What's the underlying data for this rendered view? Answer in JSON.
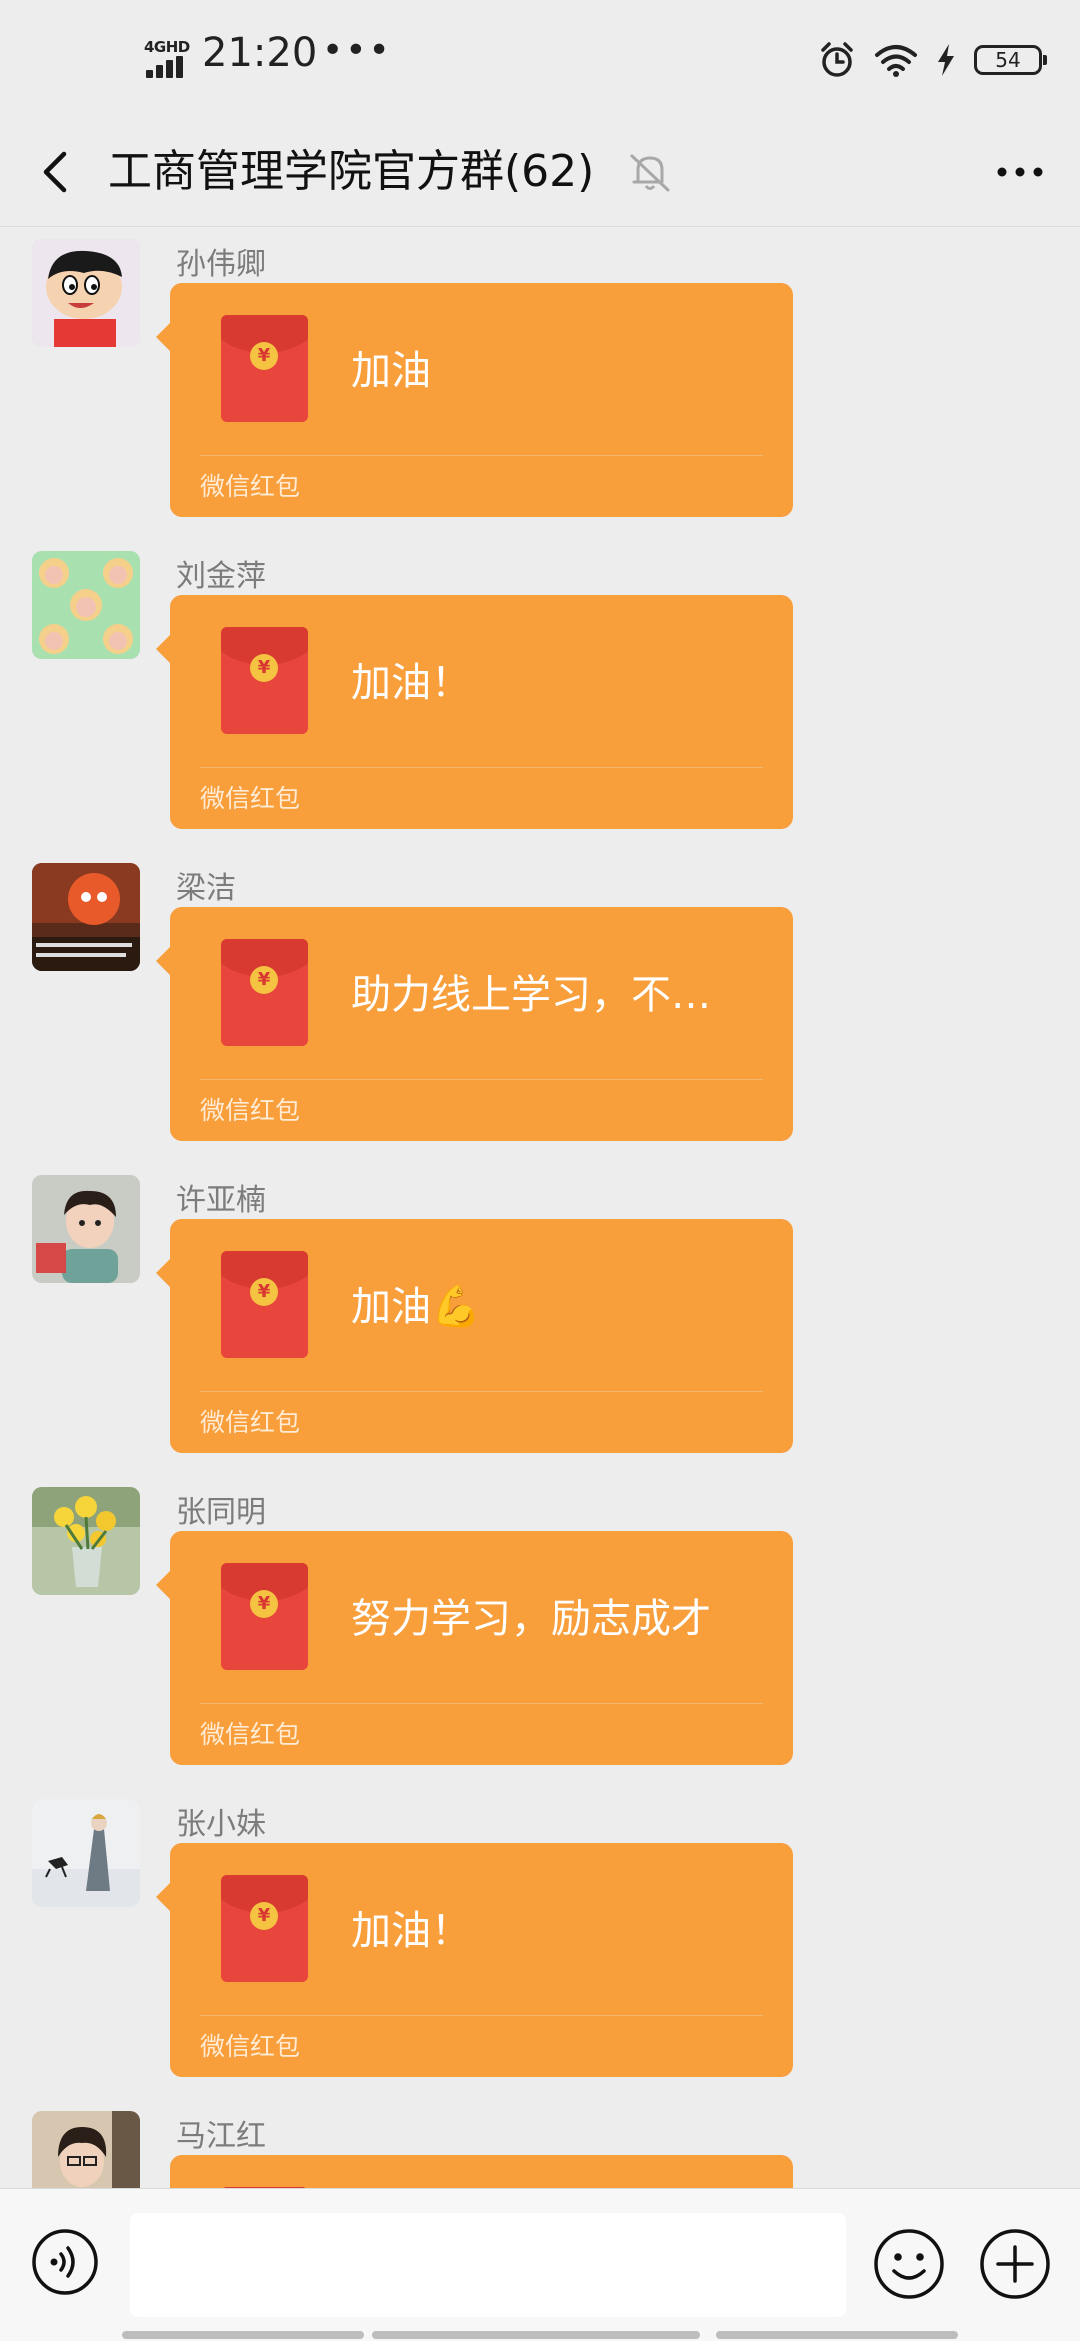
{
  "status_bar": {
    "network": "4GHD",
    "time": "21:20",
    "dots": "•••",
    "battery": "54"
  },
  "nav": {
    "title": "工商管理学院官方群(62)"
  },
  "messages": [
    {
      "sender": "孙伟卿",
      "text": "加油",
      "label": "微信红包"
    },
    {
      "sender": "刘金萍",
      "text": "加油！",
      "label": "微信红包"
    },
    {
      "sender": "梁洁",
      "text": "助力线上学习，不…",
      "label": "微信红包"
    },
    {
      "sender": "许亚楠",
      "text": "加油💪",
      "label": "微信红包"
    },
    {
      "sender": "张同明",
      "text": "努力学习，励志成才",
      "label": "微信红包"
    },
    {
      "sender": "张小妹",
      "text": "加油！",
      "label": "微信红包"
    },
    {
      "sender": "马江红",
      "text": "",
      "label": ""
    }
  ],
  "currency_symbol": "¥",
  "colors": {
    "bubble": "#F89E3B",
    "envelope": "#E8453C",
    "background": "#EDEDED"
  }
}
